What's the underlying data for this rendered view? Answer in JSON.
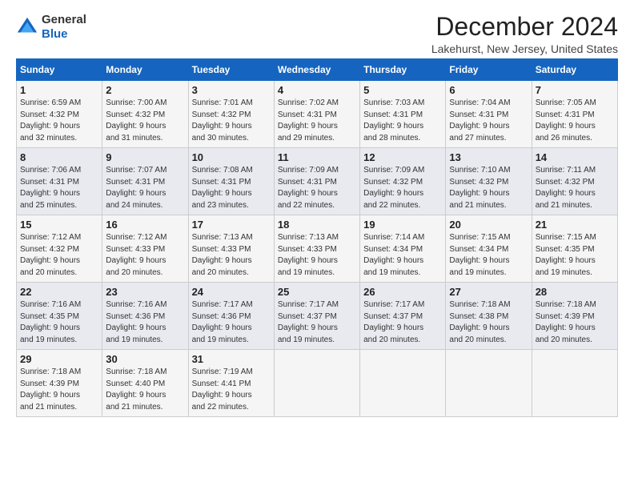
{
  "logo": {
    "line1": "General",
    "line2": "Blue"
  },
  "title": "December 2024",
  "subtitle": "Lakehurst, New Jersey, United States",
  "days_of_week": [
    "Sunday",
    "Monday",
    "Tuesday",
    "Wednesday",
    "Thursday",
    "Friday",
    "Saturday"
  ],
  "weeks": [
    [
      {
        "day": "1",
        "info": "Sunrise: 6:59 AM\nSunset: 4:32 PM\nDaylight: 9 hours\nand 32 minutes."
      },
      {
        "day": "2",
        "info": "Sunrise: 7:00 AM\nSunset: 4:32 PM\nDaylight: 9 hours\nand 31 minutes."
      },
      {
        "day": "3",
        "info": "Sunrise: 7:01 AM\nSunset: 4:32 PM\nDaylight: 9 hours\nand 30 minutes."
      },
      {
        "day": "4",
        "info": "Sunrise: 7:02 AM\nSunset: 4:31 PM\nDaylight: 9 hours\nand 29 minutes."
      },
      {
        "day": "5",
        "info": "Sunrise: 7:03 AM\nSunset: 4:31 PM\nDaylight: 9 hours\nand 28 minutes."
      },
      {
        "day": "6",
        "info": "Sunrise: 7:04 AM\nSunset: 4:31 PM\nDaylight: 9 hours\nand 27 minutes."
      },
      {
        "day": "7",
        "info": "Sunrise: 7:05 AM\nSunset: 4:31 PM\nDaylight: 9 hours\nand 26 minutes."
      }
    ],
    [
      {
        "day": "8",
        "info": "Sunrise: 7:06 AM\nSunset: 4:31 PM\nDaylight: 9 hours\nand 25 minutes."
      },
      {
        "day": "9",
        "info": "Sunrise: 7:07 AM\nSunset: 4:31 PM\nDaylight: 9 hours\nand 24 minutes."
      },
      {
        "day": "10",
        "info": "Sunrise: 7:08 AM\nSunset: 4:31 PM\nDaylight: 9 hours\nand 23 minutes."
      },
      {
        "day": "11",
        "info": "Sunrise: 7:09 AM\nSunset: 4:31 PM\nDaylight: 9 hours\nand 22 minutes."
      },
      {
        "day": "12",
        "info": "Sunrise: 7:09 AM\nSunset: 4:32 PM\nDaylight: 9 hours\nand 22 minutes."
      },
      {
        "day": "13",
        "info": "Sunrise: 7:10 AM\nSunset: 4:32 PM\nDaylight: 9 hours\nand 21 minutes."
      },
      {
        "day": "14",
        "info": "Sunrise: 7:11 AM\nSunset: 4:32 PM\nDaylight: 9 hours\nand 21 minutes."
      }
    ],
    [
      {
        "day": "15",
        "info": "Sunrise: 7:12 AM\nSunset: 4:32 PM\nDaylight: 9 hours\nand 20 minutes."
      },
      {
        "day": "16",
        "info": "Sunrise: 7:12 AM\nSunset: 4:33 PM\nDaylight: 9 hours\nand 20 minutes."
      },
      {
        "day": "17",
        "info": "Sunrise: 7:13 AM\nSunset: 4:33 PM\nDaylight: 9 hours\nand 20 minutes."
      },
      {
        "day": "18",
        "info": "Sunrise: 7:13 AM\nSunset: 4:33 PM\nDaylight: 9 hours\nand 19 minutes."
      },
      {
        "day": "19",
        "info": "Sunrise: 7:14 AM\nSunset: 4:34 PM\nDaylight: 9 hours\nand 19 minutes."
      },
      {
        "day": "20",
        "info": "Sunrise: 7:15 AM\nSunset: 4:34 PM\nDaylight: 9 hours\nand 19 minutes."
      },
      {
        "day": "21",
        "info": "Sunrise: 7:15 AM\nSunset: 4:35 PM\nDaylight: 9 hours\nand 19 minutes."
      }
    ],
    [
      {
        "day": "22",
        "info": "Sunrise: 7:16 AM\nSunset: 4:35 PM\nDaylight: 9 hours\nand 19 minutes."
      },
      {
        "day": "23",
        "info": "Sunrise: 7:16 AM\nSunset: 4:36 PM\nDaylight: 9 hours\nand 19 minutes."
      },
      {
        "day": "24",
        "info": "Sunrise: 7:17 AM\nSunset: 4:36 PM\nDaylight: 9 hours\nand 19 minutes."
      },
      {
        "day": "25",
        "info": "Sunrise: 7:17 AM\nSunset: 4:37 PM\nDaylight: 9 hours\nand 19 minutes."
      },
      {
        "day": "26",
        "info": "Sunrise: 7:17 AM\nSunset: 4:37 PM\nDaylight: 9 hours\nand 20 minutes."
      },
      {
        "day": "27",
        "info": "Sunrise: 7:18 AM\nSunset: 4:38 PM\nDaylight: 9 hours\nand 20 minutes."
      },
      {
        "day": "28",
        "info": "Sunrise: 7:18 AM\nSunset: 4:39 PM\nDaylight: 9 hours\nand 20 minutes."
      }
    ],
    [
      {
        "day": "29",
        "info": "Sunrise: 7:18 AM\nSunset: 4:39 PM\nDaylight: 9 hours\nand 21 minutes."
      },
      {
        "day": "30",
        "info": "Sunrise: 7:18 AM\nSunset: 4:40 PM\nDaylight: 9 hours\nand 21 minutes."
      },
      {
        "day": "31",
        "info": "Sunrise: 7:19 AM\nSunset: 4:41 PM\nDaylight: 9 hours\nand 22 minutes."
      },
      {
        "day": "",
        "info": ""
      },
      {
        "day": "",
        "info": ""
      },
      {
        "day": "",
        "info": ""
      },
      {
        "day": "",
        "info": ""
      }
    ]
  ]
}
